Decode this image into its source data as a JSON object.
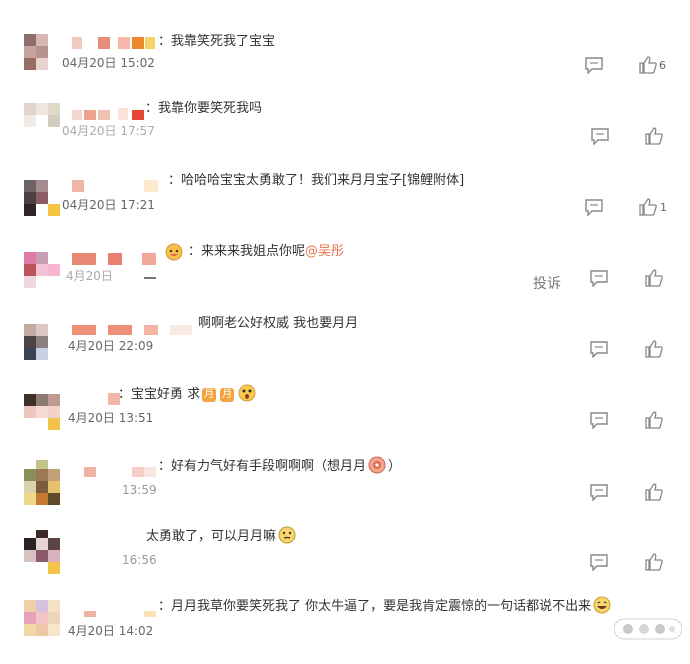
{
  "comments": [
    {
      "text": "：我靠笑死我了宝宝",
      "time": "04月20日 15:02",
      "likes": "6"
    },
    {
      "text": "：我靠你要笑死我吗",
      "time": "04月20日 17:57",
      "likes": ""
    },
    {
      "text": "：哈哈哈宝宝太勇敢了！我们来月月宝子[锦鲤附体]",
      "time": "04月20日 17:21",
      "likes": "1"
    },
    {
      "text_before": "：来来来我姐点你呢",
      "mention": "@吴彤",
      "time": "",
      "likes": "",
      "report": "投诉"
    },
    {
      "text": "啊啊老公好权威 我也要月月",
      "time": "4月20日 22:09",
      "likes": ""
    },
    {
      "text_before": "：宝宝好勇 求",
      "badge_a": "月",
      "badge_b": "月",
      "time": "4月20日 13:51",
      "likes": ""
    },
    {
      "text_before": "：好有力气好有手段啊啊啊（想月月",
      "text_after": "）",
      "time": "13:59",
      "likes": ""
    },
    {
      "text": "太勇敢了，可以月月嘛",
      "time": "16:56",
      "likes": ""
    },
    {
      "text": "：月月我草你要笑死我了 你太牛逼了，要是我肯定震惊的一句话都说不出来",
      "time": "4月20日 14:02",
      "likes": ""
    }
  ],
  "colors": {
    "mention": "#eb7350",
    "badge": "#f4a340",
    "icon": "#888888"
  }
}
